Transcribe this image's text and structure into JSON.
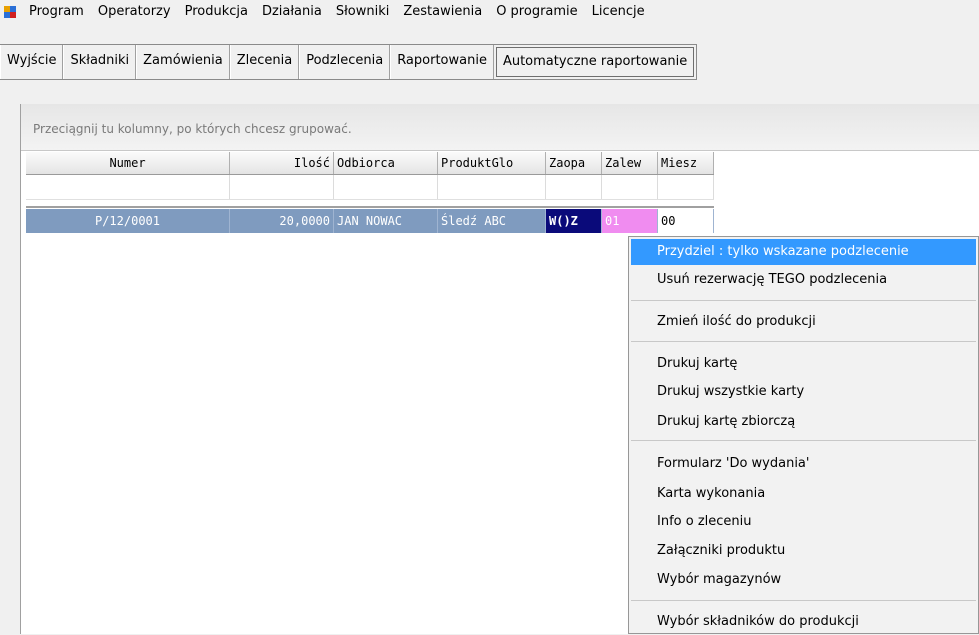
{
  "menubar": {
    "items": [
      "Program",
      "Operatorzy",
      "Produkcja",
      "Działania",
      "Słowniki",
      "Zestawienia",
      "O programie",
      "Licencje"
    ]
  },
  "toolbar": {
    "buttons": [
      "Wyjście",
      "Składniki",
      "Zamówienia",
      "Zlecenia",
      "Podzlecenia",
      "Raportowanie",
      "Automatyczne raportowanie"
    ]
  },
  "grid": {
    "group_hint": "Przeciągnij tu kolumny, po których chcesz grupować.",
    "columns": [
      "Numer",
      "Ilość",
      "Odbiorca",
      "ProduktGlo",
      "Zaopa",
      "Zalew",
      "Miesz"
    ],
    "rows": [
      [
        "P/12/0001",
        "20,0000",
        "JAN NOWAC",
        "Śledź ABC",
        "W()Z",
        "01",
        "00"
      ]
    ]
  },
  "context_menu": {
    "items": [
      "Przydziel : tylko wskazane podzlecenie",
      "Usuń rezerwację TEGO podzlecenia",
      "Zmień ilość do produkcji",
      "Drukuj kartę",
      "Drukuj wszystkie karty",
      "Drukuj kartę zbiorczą",
      "Formularz 'Do wydania'",
      "Karta wykonania",
      "Info o zleceniu",
      "Załączniki produktu",
      "Wybór magazynów",
      "Wybór składników do produkcji"
    ],
    "highlighted": "Przydziel : tylko wskazane podzlecenie"
  },
  "colors": {
    "selected_row": "#7f9bbf",
    "menu_highlight": "#3399ff",
    "zaopa_cell": "#0a0a7a",
    "zalew_cell": "#f08cf0"
  }
}
